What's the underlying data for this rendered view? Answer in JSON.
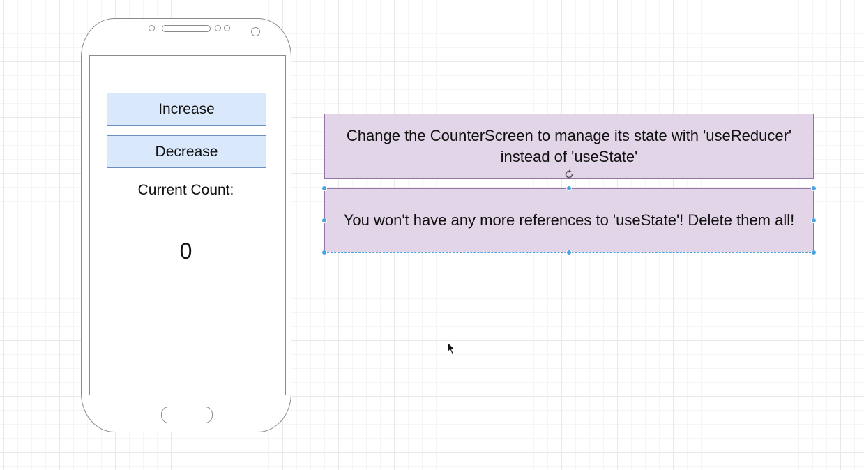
{
  "phone": {
    "increase_label": "Increase",
    "decrease_label": "Decrease",
    "count_label": "Current Count:",
    "count_value": "0"
  },
  "notes": [
    {
      "text": "Change the CounterScreen to manage its state with 'useReducer' instead of 'useState'"
    },
    {
      "text": "You won't have any more references to 'useState'!  Delete them all!"
    }
  ],
  "colors": {
    "button_fill": "#dae8fc",
    "button_stroke": "#6c8ebf",
    "note_fill": "#e1d5e7",
    "note_stroke": "#9673a6",
    "selection": "#4aa3df"
  },
  "icons": {
    "rotate": "rotate-icon",
    "cursor": "mouse-pointer-icon"
  }
}
